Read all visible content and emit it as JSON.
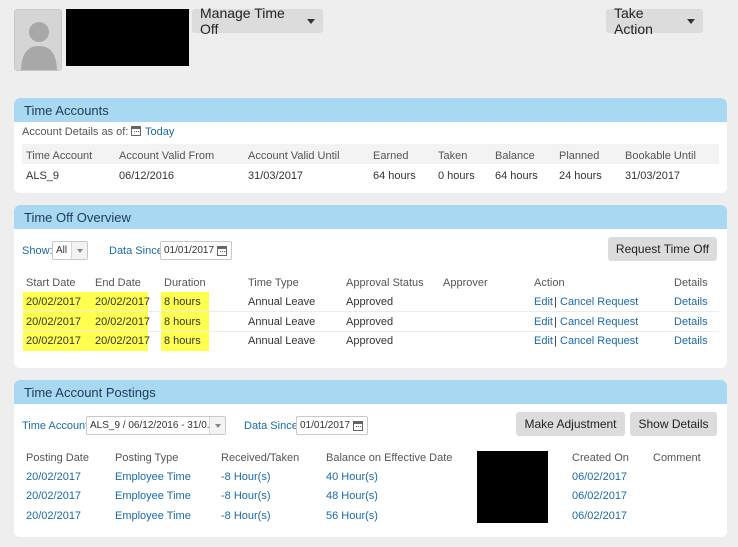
{
  "header": {
    "manage_label": "Manage Time Off",
    "action_label": "Take Action"
  },
  "time_accounts": {
    "title": "Time Accounts",
    "details_label": "Account Details as of:",
    "today_label": "Today",
    "columns": [
      "Time Account",
      "Account Valid From",
      "Account Valid Until",
      "Earned",
      "Taken",
      "Balance",
      "Planned",
      "Bookable Until"
    ],
    "row": [
      "ALS_9",
      "06/12/2016",
      "31/03/2017",
      "64 hours",
      "0 hours",
      "64 hours",
      "24 hours",
      "31/03/2017"
    ]
  },
  "overview": {
    "title": "Time Off Overview",
    "show_label": "Show:",
    "show_value": "All",
    "data_since_label": "Data Since",
    "data_since_value": "01/01/2017",
    "request_button": "Request Time Off",
    "columns": [
      "Start Date",
      "End Date",
      "Duration",
      "Time Type",
      "Approval Status",
      "Approver",
      "Action",
      "Details"
    ],
    "rows": [
      {
        "start": "20/02/2017",
        "end": "20/02/2017",
        "duration": "8 hours",
        "type": "Annual Leave",
        "status": "Approved",
        "edit": "Edit",
        "sep": "|",
        "cancel": "Cancel Request",
        "details": "Details"
      },
      {
        "start": "20/02/2017",
        "end": "20/02/2017",
        "duration": "8 hours",
        "type": "Annual Leave",
        "status": "Approved",
        "edit": "Edit",
        "sep": "|",
        "cancel": "Cancel Request",
        "details": "Details"
      },
      {
        "start": "20/02/2017",
        "end": "20/02/2017",
        "duration": "8 hours",
        "type": "Annual Leave",
        "status": "Approved",
        "edit": "Edit",
        "sep": "|",
        "cancel": "Cancel Request",
        "details": "Details"
      }
    ]
  },
  "postings": {
    "title": "Time Account Postings",
    "time_account_label": "Time Account",
    "time_account_value": "ALS_9 / 06/12/2016 - 31/0...",
    "data_since_label": "Data Since",
    "data_since_value": "01/01/2017",
    "make_adjustment": "Make Adjustment",
    "show_details": "Show Details",
    "columns": [
      "Posting Date",
      "Posting Type",
      "Received/Taken",
      "Balance on Effective Date",
      "Created On",
      "Comment"
    ],
    "rows": [
      {
        "date": "20/02/2017",
        "type": "Employee Time",
        "received": "-8 Hour(s)",
        "balance": "40 Hour(s)",
        "created": "06/02/2017"
      },
      {
        "date": "20/02/2017",
        "type": "Employee Time",
        "received": "-8 Hour(s)",
        "balance": "48 Hour(s)",
        "created": "06/02/2017"
      },
      {
        "date": "20/02/2017",
        "type": "Employee Time",
        "received": "-8 Hour(s)",
        "balance": "56 Hour(s)",
        "created": "06/02/2017"
      }
    ]
  },
  "colors": {
    "panel_header": "#a9d8f2",
    "link": "#1b6aa8",
    "highlight": "#ffff4d",
    "button": "#dcdcdc"
  }
}
